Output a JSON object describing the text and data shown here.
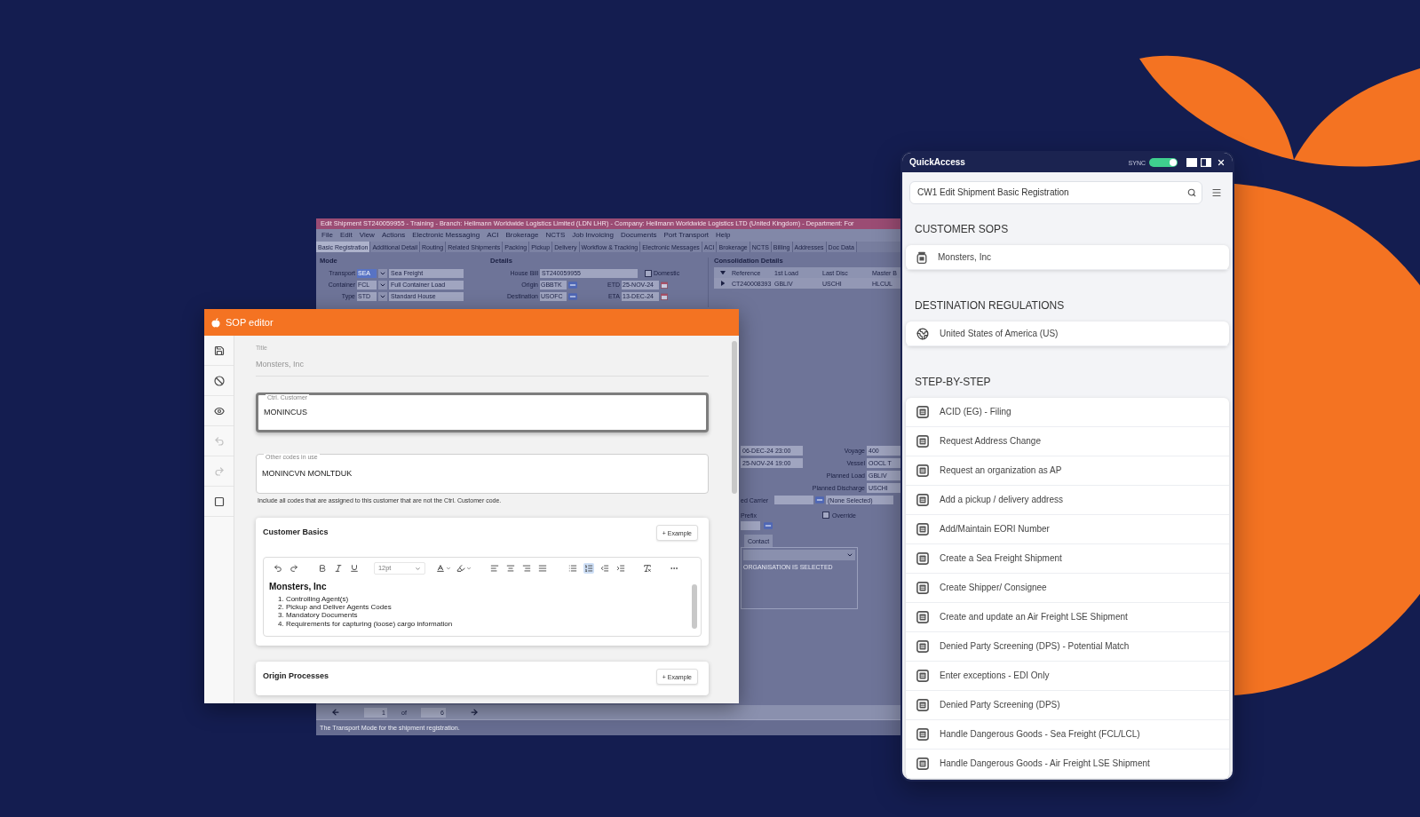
{
  "shipment_window": {
    "title": "Edit Shipment ST240059955 - Training - Branch: Hellmann Worldwide Logistics Limited (LDN LHR) - Company: Hellmann Worldwide Logistics LTD (United Kingdom) - Department: For",
    "menu": [
      "File",
      "Edit",
      "View",
      "Actions",
      "Electronic Messaging",
      "ACI",
      "Brokerage",
      "NCTS",
      "Job Invoicing",
      "Documents",
      "Port Transport",
      "Help"
    ],
    "tabs": [
      {
        "label": "Basic Registration",
        "selected": true
      },
      {
        "label": "Additional Detail",
        "selected": false
      },
      {
        "label": "Routing",
        "selected": false
      },
      {
        "label": "Related Shipments",
        "selected": false
      },
      {
        "label": "Packing",
        "selected": false
      },
      {
        "label": "Pickup",
        "selected": false
      },
      {
        "label": "Delivery",
        "selected": false
      },
      {
        "label": "Workflow & Tracking",
        "selected": false
      },
      {
        "label": "Electronic Messages",
        "selected": false
      },
      {
        "label": "ACI",
        "selected": false
      },
      {
        "label": "Brokerage",
        "selected": false
      },
      {
        "label": "NCTS",
        "selected": false
      },
      {
        "label": "Billing",
        "selected": false
      },
      {
        "label": "Addresses",
        "selected": false
      },
      {
        "label": "Doc Data",
        "selected": false
      }
    ],
    "mode": {
      "heading": "Mode",
      "rows": [
        {
          "label": "Transport",
          "code": "SEA",
          "description": "Sea Freight",
          "selected": true
        },
        {
          "label": "Container",
          "code": "FCL",
          "description": "Full Container Load",
          "selected": false
        },
        {
          "label": "Type",
          "code": "STD",
          "description": "Standard House",
          "selected": false
        }
      ]
    },
    "details": {
      "heading": "Details",
      "house_bill": {
        "label": "House Bill",
        "value": "ST240059955"
      },
      "domestic": {
        "label": "Domestic",
        "checked": false
      },
      "rows": [
        {
          "label": "Origin",
          "value": "GBBTK",
          "date_label": "ETD",
          "date": "25-NOV-24"
        },
        {
          "label": "Destination",
          "value": "USOFC",
          "date_label": "ETA",
          "date": "13-DEC-24"
        }
      ]
    },
    "consolidation": {
      "heading": "Consolidation Details",
      "columns": [
        "Reference",
        "1st Load",
        "Last Disc",
        "Master B"
      ],
      "rows": [
        [
          "CT240008393",
          "GBLIV",
          "USCHI",
          "HLCUL"
        ]
      ]
    },
    "schedule": [
      {
        "time": "06-DEC-24 23:00",
        "label": "Voyage",
        "value": "400"
      },
      {
        "time": "25-NOV-24 19:00",
        "label": "Vessel",
        "value": "OOCL T"
      },
      {
        "label": "Planned Load",
        "value": "GBLIV"
      },
      {
        "label": "Planned Discharge",
        "value": "USCHI"
      }
    ],
    "carrier": {
      "label": "ed Carrier",
      "value": "(None Selected)"
    },
    "prefix": {
      "label": "Prefix"
    },
    "override": {
      "label": "Override",
      "checked": false
    },
    "contact_tab": "Contact",
    "organisation_note": "ORGANISATION IS SELECTED",
    "pager": {
      "page": "1",
      "of": "of",
      "total": "6"
    },
    "status": "The Transport Mode for the shipment registration."
  },
  "sop_editor": {
    "title": "SOP editor",
    "tools": [
      {
        "kind": "save",
        "disabled": false
      },
      {
        "kind": "ban",
        "disabled": false
      },
      {
        "kind": "preview",
        "disabled": false
      },
      {
        "kind": "undo",
        "disabled": true
      },
      {
        "kind": "redo",
        "disabled": true
      },
      {
        "kind": "frame",
        "disabled": false
      }
    ],
    "title_field": {
      "label": "Title",
      "value": "Monsters, Inc"
    },
    "fields": [
      {
        "label": "Ctrl. Customer",
        "value": "MONINCUS",
        "focused": true
      },
      {
        "label": "Other codes in use",
        "value": "MONINCVN MONLTDUK",
        "focused": false
      }
    ],
    "helper": "Include all codes that are assigned to this customer that are not the Ctrl. Customer code.",
    "sections": [
      {
        "title": "Customer Basics",
        "button": "+ Example",
        "editor": {
          "toolbar": [
            {
              "kind": "undo",
              "active": false
            },
            {
              "kind": "redo",
              "active": false
            },
            {
              "kind": "bold",
              "active": false
            },
            {
              "kind": "italic",
              "active": false
            },
            {
              "kind": "underline",
              "active": false
            },
            {
              "kind": "font-size",
              "label": "12pt",
              "active": false
            },
            {
              "kind": "text-color",
              "active": false
            },
            {
              "kind": "highlight",
              "active": false
            },
            {
              "kind": "align-left",
              "active": false
            },
            {
              "kind": "align-center",
              "active": false
            },
            {
              "kind": "align-right",
              "active": false
            },
            {
              "kind": "align-justify",
              "active": false
            },
            {
              "kind": "bullet-list",
              "active": false
            },
            {
              "kind": "numbered-list",
              "active": true
            },
            {
              "kind": "outdent",
              "active": false
            },
            {
              "kind": "indent",
              "active": false
            },
            {
              "kind": "clear-format",
              "active": false
            },
            {
              "kind": "more",
              "active": false
            }
          ],
          "heading": "Monsters, Inc",
          "lines": [
            "1. Controlling Agent(s)",
            "2. Pickup and Deliver Agents Codes",
            "3. Mandatory Documents",
            "4. Requirements for capturing (loose) cargo information"
          ]
        }
      },
      {
        "title": "Origin Processes",
        "button": "+ Example"
      }
    ]
  },
  "quick_access": {
    "title": "QuickAccess",
    "sync": {
      "label": "SYNC",
      "on": true
    },
    "search": {
      "value": "CW1 Edit Shipment Basic Registration"
    },
    "sections": [
      {
        "heading": "CUSTOMER SOPS",
        "items": [
          {
            "kind": "sop",
            "label": "Monsters, Inc"
          }
        ]
      },
      {
        "heading": "DESTINATION REGULATIONS",
        "items": [
          {
            "kind": "regulation",
            "label": "United States of America (US)"
          }
        ]
      },
      {
        "heading": "STEP-BY-STEP",
        "items": [
          {
            "kind": "guide",
            "label": "ACID (EG) - Filing"
          },
          {
            "kind": "guide",
            "label": "Request Address Change"
          },
          {
            "kind": "guide",
            "label": "Request an organization as AP"
          },
          {
            "kind": "guide",
            "label": "Add a pickup / delivery address"
          },
          {
            "kind": "guide",
            "label": "Add/Maintain EORI Number"
          },
          {
            "kind": "guide",
            "label": "Create a Sea Freight Shipment"
          },
          {
            "kind": "guide",
            "label": "Create Shipper/ Consignee"
          },
          {
            "kind": "guide",
            "label": "Create and update an Air Freight LSE Shipment"
          },
          {
            "kind": "guide",
            "label": "Denied Party Screening (DPS) - Potential Match"
          },
          {
            "kind": "guide",
            "label": "Enter exceptions - EDI Only"
          },
          {
            "kind": "guide",
            "label": "Denied Party Screening (DPS)"
          },
          {
            "kind": "guide",
            "label": "Handle Dangerous Goods - Sea Freight (FCL/LCL)"
          },
          {
            "kind": "guide",
            "label": "Handle Dangerous Goods - Air Freight LSE Shipment"
          }
        ]
      }
    ]
  }
}
